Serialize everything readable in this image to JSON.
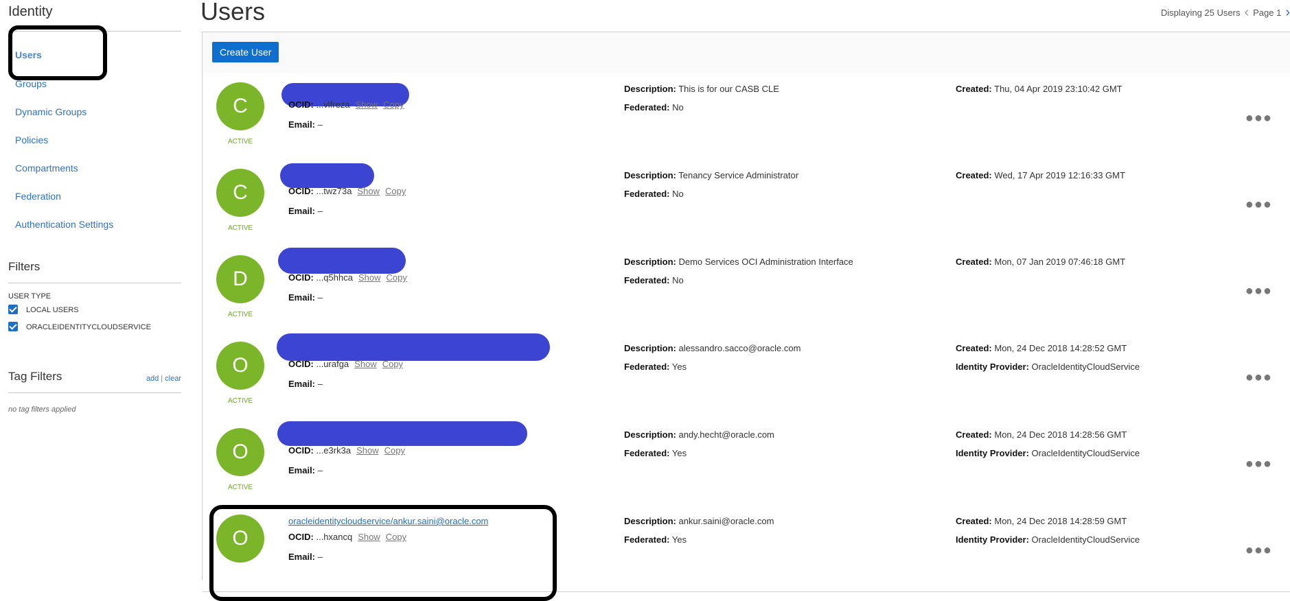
{
  "sidebar": {
    "title": "Identity",
    "nav": [
      {
        "label": "Users",
        "active": true
      },
      {
        "label": "Groups"
      },
      {
        "label": "Dynamic Groups"
      },
      {
        "label": "Policies"
      },
      {
        "label": "Compartments"
      },
      {
        "label": "Federation"
      },
      {
        "label": "Authentication Settings"
      }
    ],
    "filters_title": "Filters",
    "user_type_label": "USER TYPE",
    "user_types": [
      {
        "label": "LOCAL USERS",
        "checked": true
      },
      {
        "label": "ORACLEIDENTITYCLOUDSERVICE",
        "checked": true
      }
    ],
    "tag_filters_title": "Tag Filters",
    "tag_add": "add",
    "tag_sep": "|",
    "tag_clear": "clear",
    "no_tags": "no tag filters applied"
  },
  "header": {
    "title": "Users",
    "displaying": "Displaying 25 Users",
    "page": "Page 1"
  },
  "toolbar": {
    "create_label": "Create User"
  },
  "labels": {
    "ocid": "OCID:",
    "show": "Show",
    "copy": "Copy",
    "email": "Email:",
    "description": "Description:",
    "federated": "Federated:",
    "created": "Created:",
    "idp": "Identity Provider:"
  },
  "users": [
    {
      "initial": "C",
      "state": "ACTIVE",
      "name": "",
      "ocid": "...vlfreza",
      "email": "–",
      "description": "This is for our CASB CLE",
      "federated": "No",
      "created": "Thu, 04 Apr 2019 23:10:42 GMT",
      "idp": ""
    },
    {
      "initial": "C",
      "state": "ACTIVE",
      "name": "",
      "ocid": "...twz73a",
      "email": "–",
      "description": "Tenancy Service Administrator",
      "federated": "No",
      "created": "Wed, 17 Apr 2019 12:16:33 GMT",
      "idp": ""
    },
    {
      "initial": "D",
      "state": "ACTIVE",
      "name": "",
      "ocid": "...q5hhca",
      "email": "–",
      "description": "Demo Services OCI Administration Interface",
      "federated": "No",
      "created": "Mon, 07 Jan 2019 07:46:18 GMT",
      "idp": ""
    },
    {
      "initial": "O",
      "state": "ACTIVE",
      "name": "",
      "ocid": "...urafga",
      "email": "–",
      "description": "alessandro.sacco@oracle.com",
      "federated": "Yes",
      "created": "Mon, 24 Dec 2018 14:28:52 GMT",
      "idp": "OracleIdentityCloudService"
    },
    {
      "initial": "O",
      "state": "ACTIVE",
      "name": "",
      "ocid": "...e3rk3a",
      "email": "–",
      "description": "andy.hecht@oracle.com",
      "federated": "Yes",
      "created": "Mon, 24 Dec 2018 14:28:56 GMT",
      "idp": "OracleIdentityCloudService"
    },
    {
      "initial": "O",
      "state": "",
      "name": "oracleidentitycloudservice/ankur.saini@oracle.com",
      "ocid": "...hxancq",
      "email": "–",
      "description": "ankur.saini@oracle.com",
      "federated": "Yes",
      "created": "Mon, 24 Dec 2018 14:28:59 GMT",
      "idp": "OracleIdentityCloudService"
    }
  ],
  "colors": {
    "accent": "#0f6fcf",
    "avatar": "#7ab52a",
    "redaction": "#3c45d1",
    "active_state": "#6aa72c"
  }
}
